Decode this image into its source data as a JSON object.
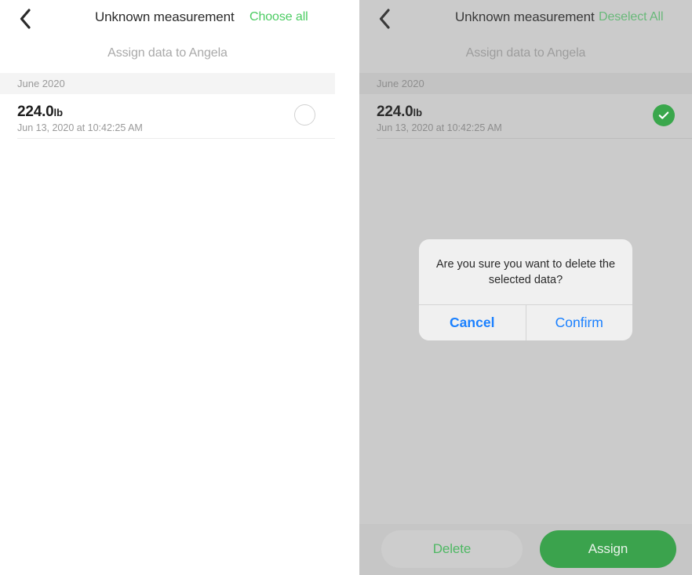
{
  "panels": [
    {
      "id": "unselected-state",
      "nav": {
        "back_icon": "chevron-left-icon",
        "title": "Unknown measurement",
        "action_label": "Choose all"
      },
      "subtitle": "Assign data to Angela",
      "section_header": "June 2020",
      "measurement": {
        "value": "224.0",
        "unit": "lb",
        "timestamp": "Jun 13, 2020 at 10:42:25 AM",
        "selected": false,
        "checkbox_icon": "circle-outline-icon"
      }
    },
    {
      "id": "selected-state",
      "nav": {
        "back_icon": "chevron-left-icon",
        "title": "Unknown measurement",
        "action_label": "Deselect All"
      },
      "subtitle": "Assign data to Angela",
      "section_header": "June 2020",
      "measurement": {
        "value": "224.0",
        "unit": "lb",
        "timestamp": "Jun 13, 2020 at 10:42:25 AM",
        "selected": true,
        "checkbox_icon": "check-circle-icon"
      },
      "bottom_bar": {
        "delete_label": "Delete",
        "assign_label": "Assign"
      },
      "dialog": {
        "message": "Are you sure you want to delete the selected data?",
        "cancel_label": "Cancel",
        "confirm_label": "Confirm"
      }
    }
  ],
  "colors": {
    "accent_green": "#4ccc63",
    "accent_green_dimmed": "#69b97a",
    "assign_green": "#3ba34d",
    "check_green": "#3aa74c",
    "dialog_blue": "#1a80ff",
    "dim_overlay": "#cbcbcb",
    "band_gray": "#f4f4f4"
  }
}
